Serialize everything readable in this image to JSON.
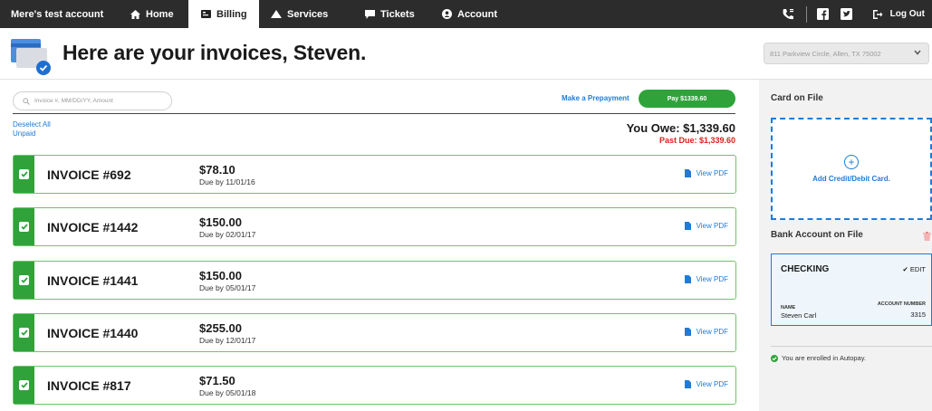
{
  "nav": {
    "account_name": "Mere's test account",
    "tabs": [
      {
        "label": "Home",
        "icon": "home-icon"
      },
      {
        "label": "Billing",
        "icon": "billing-icon"
      },
      {
        "label": "Services",
        "icon": "services-icon"
      },
      {
        "label": "Tickets",
        "icon": "tickets-icon"
      },
      {
        "label": "Account",
        "icon": "account-icon"
      }
    ],
    "active_tab": "Billing",
    "logout_label": "Log Out"
  },
  "header": {
    "title": "Here are your invoices, Steven.",
    "address_select": "811 Parkview Circle, Allen, TX 75002"
  },
  "toolbar": {
    "search_placeholder": "Invoice #, MM/DD/YY, Amount",
    "prepay_label": "Make a Prepayment",
    "pay_label": "Pay $1339.60"
  },
  "selection": {
    "deselect_all": "Deselect All",
    "unpaid": "Unpaid"
  },
  "summary": {
    "you_owe": "You Owe: $1,339.60",
    "past_due": "Past Due: $1,339.60"
  },
  "invoices": [
    {
      "number": "INVOICE #692",
      "amount": "$78.10",
      "due": "Due by 11/01/16",
      "pdf": "View PDF",
      "checked": true
    },
    {
      "number": "INVOICE #1442",
      "amount": "$150.00",
      "due": "Due by 02/01/17",
      "pdf": "View PDF",
      "checked": true
    },
    {
      "number": "INVOICE #1441",
      "amount": "$150.00",
      "due": "Due by 05/01/17",
      "pdf": "View PDF",
      "checked": true
    },
    {
      "number": "INVOICE #1440",
      "amount": "$255.00",
      "due": "Due by 12/01/17",
      "pdf": "View PDF",
      "checked": true
    },
    {
      "number": "INVOICE #817",
      "amount": "$71.50",
      "due": "Due by 05/01/18",
      "pdf": "View PDF",
      "checked": true
    }
  ],
  "sidebar": {
    "card_title": "Card on File",
    "add_card_label": "Add Credit/Debit Card.",
    "bank_title": "Bank Account on File",
    "bank": {
      "type": "CHECKING",
      "edit_label": "EDIT",
      "name_label": "NAME",
      "name_value": "Steven Carl",
      "account_label": "ACCOUNT NUMBER",
      "account_value": "3315"
    },
    "autopay_text": "You are enrolled in Autopay."
  },
  "colors": {
    "nav_bg": "#2c2c2c",
    "accent_green": "#2fa33a",
    "link_blue": "#1f7bd6",
    "past_due_red": "#e0201a"
  }
}
